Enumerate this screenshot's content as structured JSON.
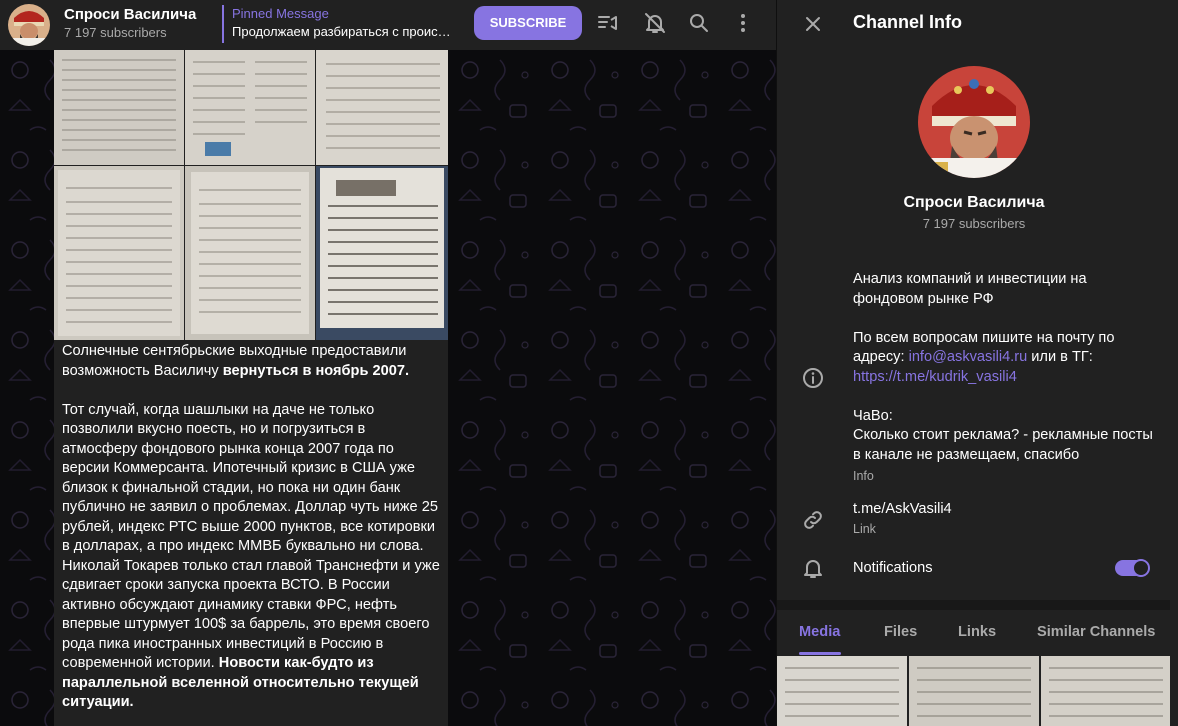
{
  "header": {
    "channel_title": "Спроси Василича",
    "subscribers": "7 197 subscribers",
    "pinned_title": "Pinned Message",
    "pinned_text": "Продолжаем разбираться с проис…",
    "subscribe_label": "SUBSCRIBE",
    "icons": [
      "live-stream-icon",
      "mute-bell-icon",
      "search-icon",
      "more-vertical-icon"
    ]
  },
  "message": {
    "paragraph1_plain": "Солнечные сентябрьские выходные предоставили возможность Василичу ",
    "paragraph1_bold": "вернуться  в ноябрь 2007.",
    "paragraph2_plain": "Тот случай, когда шашлыки на даче не только позволили вкусно поесть, но и погрузиться в атмосферу фондового рынка конца 2007 года по версии Коммерсанта. Ипотечный кризис в США уже близок к финальной стадии, но пока ни один банк публично не заявил о проблемах. Доллар чуть ниже 25 рублей, индекс РТС выше 2000 пунктов, все котировки в долларах, а про индекс ММВБ буквально ни слова. Николай Токарев только стал главой Транснефти и уже сдвигает сроки запуска проекта ВСТО. В России активно обсуждают динамику ставки ФРС, нефть впервые штурмует 100$ за баррель, это время своего рода пика иностранных инвестиций в Россию в современной истории. ",
    "paragraph2_bold": "Новости как-будто из параллельной вселенной относительно текущей ситуации."
  },
  "panel": {
    "title": "Channel Info",
    "name": "Спроси Василича",
    "subscribers": "7 197 subscribers",
    "about_line1": "Анализ компаний и инвестиции на фондовом рынке РФ",
    "about_line2_a": "По всем вопросам пишите на почту по адресу: ",
    "about_email": "info@askvasili4.ru",
    "about_line2_b": " или в ТГ: ",
    "about_tg": "https://t.me/kudrik_vasili4",
    "about_line3": "ЧаВо:",
    "about_line4": "Сколько стоит реклама? -  рекламные посты в канале не размещаем, спасибо",
    "info_label": "Info",
    "link_value": "t.me/AskVasili4",
    "link_label": "Link",
    "notifications_label": "Notifications",
    "notifications_on": true,
    "tabs": [
      "Media",
      "Files",
      "Links",
      "Similar Channels"
    ],
    "active_tab": "Media"
  },
  "colors": {
    "accent": "#8774e1",
    "panel_bg": "#212121",
    "chat_bg": "#0b0b0d",
    "muted_text": "#aaaaaa"
  }
}
